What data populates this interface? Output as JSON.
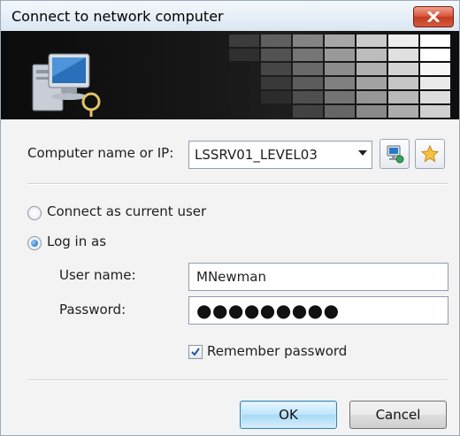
{
  "window": {
    "title": "Connect to network computer"
  },
  "computer": {
    "label": "Computer name or IP:",
    "value": "LSSRV01_LEVEL03"
  },
  "connect_options": {
    "current_user_label": "Connect as current user",
    "log_in_label": "Log in as",
    "selected": "log_in"
  },
  "credentials": {
    "username_label": "User name:",
    "username_value": "MNewman",
    "password_label": "Password:",
    "password_mask": "●●●●●●●●●"
  },
  "remember": {
    "label": "Remember password",
    "checked": true
  },
  "buttons": {
    "ok_label": "OK",
    "cancel_label": "Cancel"
  },
  "icons": {
    "close": "close-icon",
    "network_computer": "network-computer-icon",
    "browse": "browse-network-icon",
    "favorites": "favorites-star-icon"
  },
  "colors": {
    "close_button": "#d9523a",
    "default_button": "#bee6fd",
    "star": "#f5c242"
  }
}
